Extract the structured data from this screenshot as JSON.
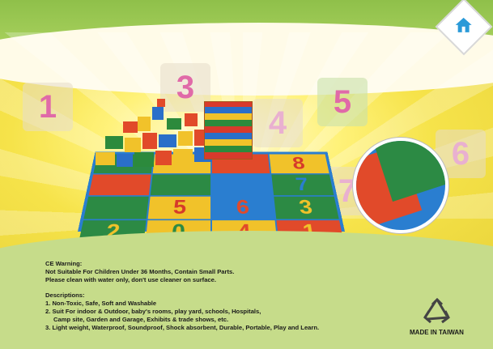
{
  "header": {
    "home_icon": "home-icon",
    "accent_color": "#2a9ad8"
  },
  "banner": {
    "ghost_numbers": [
      "1",
      "3",
      "4",
      "5",
      "6",
      "7"
    ],
    "mat_numbers": [
      "8",
      "7",
      "5",
      "6",
      "3",
      "2",
      "0",
      "4",
      "1"
    ],
    "zoom_caption": ""
  },
  "warning": {
    "title": "CE Warning:",
    "line1": "Not Suitable For Children Under 36 Months, Contain Small Parts.",
    "line2": "Please clean with water only, don't use cleaner on surface."
  },
  "descriptions": {
    "title": "Descriptions:",
    "item1": "1. Non-Toxic, Safe, Soft and Washable",
    "item2a": "2. Suit For indoor & Outdoor, baby's rooms, play yard, schools, Hospitals,",
    "item2b": "Camp site, Garden and Garage, Exhibits & trade shows, etc.",
    "item3": "3. Light weight, Waterproof, Soundproof, Shock absorbent, Durable, Portable, Play and Learn."
  },
  "footer": {
    "made_in": "MADE IN TAIWAN",
    "recycle_icon": "recycle-icon"
  }
}
